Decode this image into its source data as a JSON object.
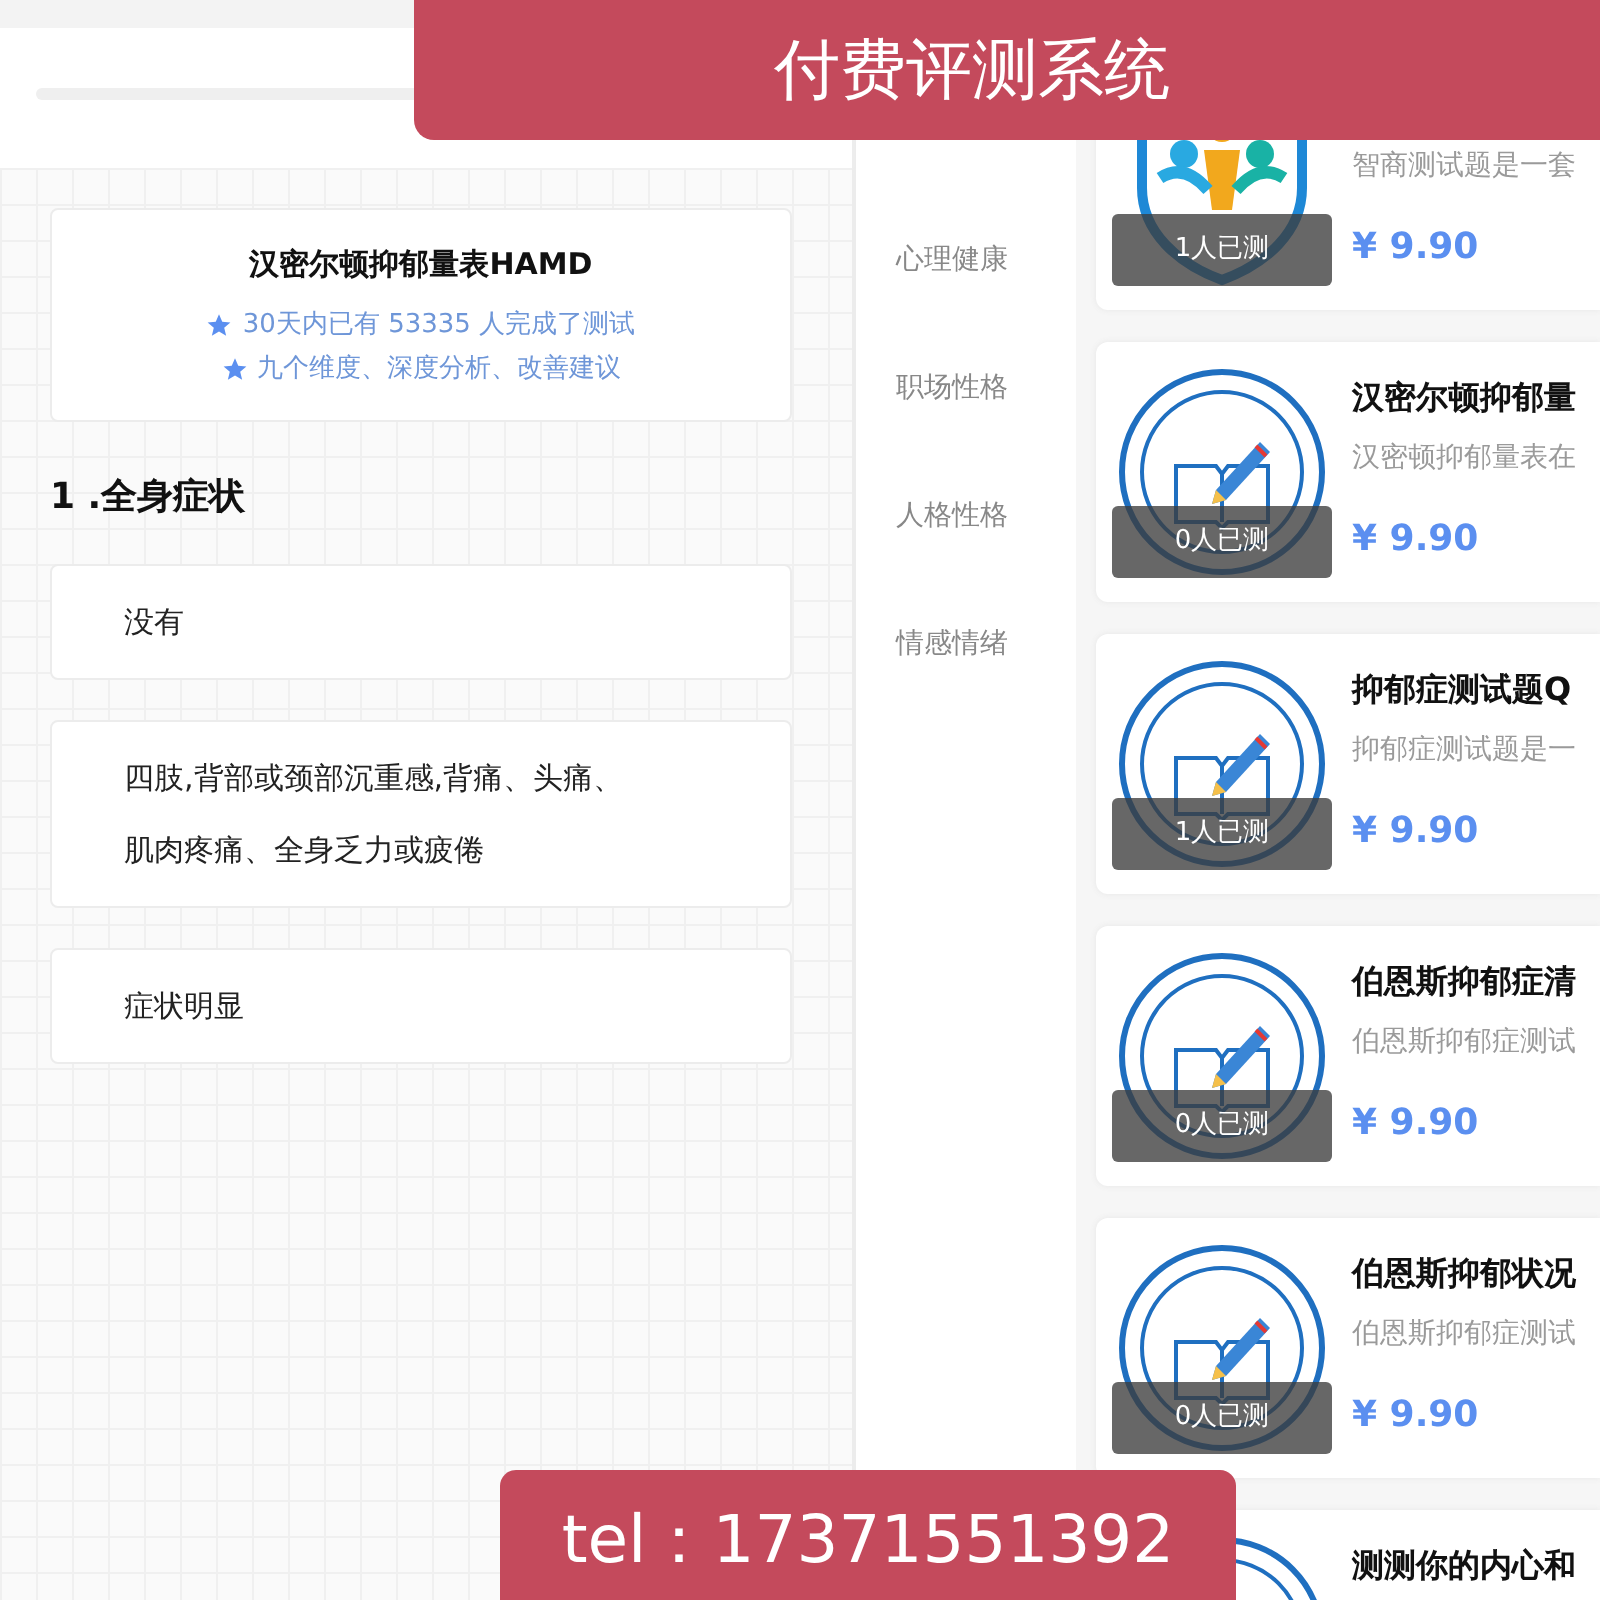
{
  "banner_title": "付费评测系统",
  "contact_banner": "tel：17371551392",
  "left_screen": {
    "scale_card": {
      "title": "汉密尔顿抑郁量表HAMD",
      "highlights": [
        "30天内已有 53335 人完成了测试",
        "九个维度、深度分析、改善建议"
      ]
    },
    "question": "1 .全身症状",
    "options": [
      {
        "lines": [
          "没有"
        ]
      },
      {
        "lines": [
          "四肢,背部或颈部沉重感,背痛、头痛、",
          "肌肉疼痛、全身乏力或疲倦"
        ]
      },
      {
        "lines": [
          "症状明显"
        ]
      }
    ]
  },
  "right_screen": {
    "categories": [
      {
        "label": "心理健康",
        "selected": false
      },
      {
        "label": "职场性格",
        "selected": false
      },
      {
        "label": "人格性格",
        "selected": false
      },
      {
        "label": "情感情绪",
        "selected": false
      }
    ],
    "tests": [
      {
        "kind": "people",
        "description": "智商测试题是一套",
        "taken": "1人已测",
        "price": "¥ 9.90"
      },
      {
        "kind": "seal",
        "title": "汉密尔顿抑郁量",
        "description": "汉密顿抑郁量表在",
        "taken": "0人已测",
        "price": "¥ 9.90"
      },
      {
        "kind": "seal",
        "title": "抑郁症测试题Q",
        "description": "抑郁症测试题是一",
        "taken": "1人已测",
        "price": "¥ 9.90"
      },
      {
        "kind": "seal",
        "title": "伯恩斯抑郁症清",
        "description": "伯恩斯抑郁症测试",
        "taken": "0人已测",
        "price": "¥ 9.90"
      },
      {
        "kind": "seal",
        "title": "伯恩斯抑郁状况",
        "description": "伯恩斯抑郁症测试",
        "taken": "0人已测",
        "price": "¥ 9.90"
      },
      {
        "kind": "seal",
        "title": "测测你的内心和"
      }
    ]
  }
}
